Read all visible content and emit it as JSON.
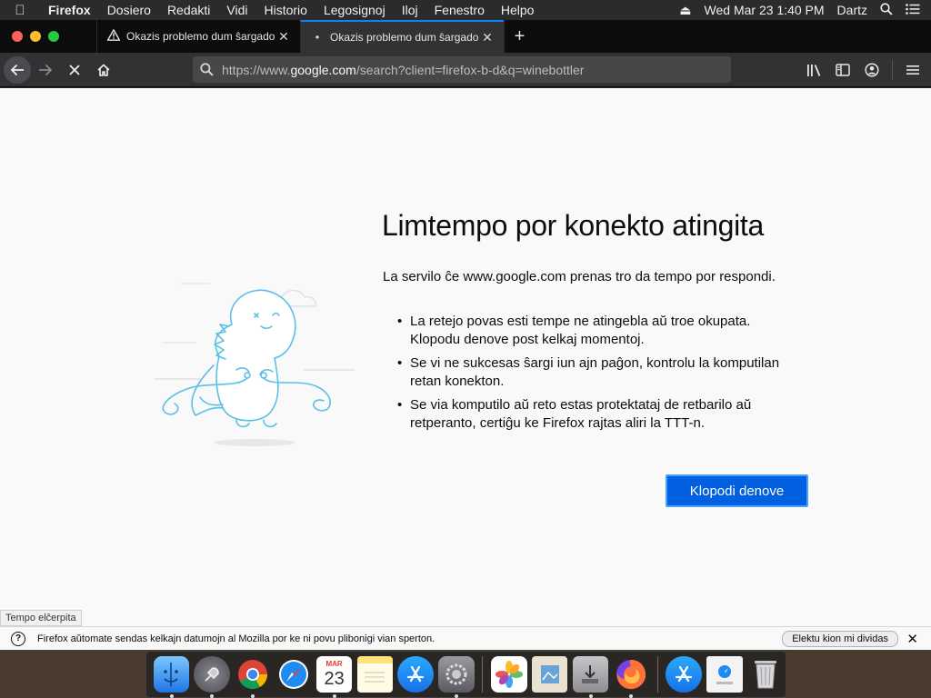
{
  "menubar": {
    "app_name": "Firefox",
    "items": [
      "Dosiero",
      "Redakti",
      "Vidi",
      "Historio",
      "Legosignoj",
      "Iloj",
      "Fenestro",
      "Helpo"
    ],
    "clock": "Wed Mar 23  1:40 PM",
    "user": "Dartz"
  },
  "tabs": [
    {
      "title": "Okazis problemo dum ŝargado de",
      "icon": "warning-icon",
      "active": false
    },
    {
      "title": "Okazis problemo dum ŝargado de",
      "icon": "loading-icon",
      "active": true
    }
  ],
  "navbar": {
    "url_scheme": "https://www.",
    "url_host": "google.com",
    "url_path": "/search?client=firefox-b-d&q=winebottler"
  },
  "error": {
    "title": "Limtempo por konekto atingita",
    "description": "La servilo ĉe www.google.com prenas tro da tempo por respondi.",
    "bullets": [
      "La retejo povas esti tempe ne atingebla aŭ troe okupata. Klopodu denove post kelkaj momentoj.",
      "Se vi ne sukcesas ŝargi iun ajn paĝon, kontrolu la komputilan retan konekton.",
      "Se via komputilo aŭ reto estas protektataj de retbarilo aŭ retperanto, certiĝu ke Firefox rajtas aliri la TTT-n."
    ],
    "retry_label": "Klopodi denove"
  },
  "status_tooltip": "Tempo elĉerpita",
  "notification": {
    "message": "Firefox aŭtomate sendas kelkajn datumojn al Mozilla por ke ni povu plibonigi vian sperton.",
    "button_label": "Elektu kion mi dividas"
  },
  "dock": {
    "apps": [
      "finder",
      "launchpad",
      "chrome",
      "safari",
      "calendar",
      "notes",
      "app-store",
      "system-preferences",
      "photos",
      "preview",
      "downloads-installer",
      "firefox",
      "app-store-2",
      "downloads-folder",
      "trash"
    ],
    "calendar_month": "MAR",
    "calendar_day": "23"
  },
  "colors": {
    "accent": "#0060df",
    "tab_highlight": "#0a84ff",
    "dino_line": "#5bc0e8"
  }
}
